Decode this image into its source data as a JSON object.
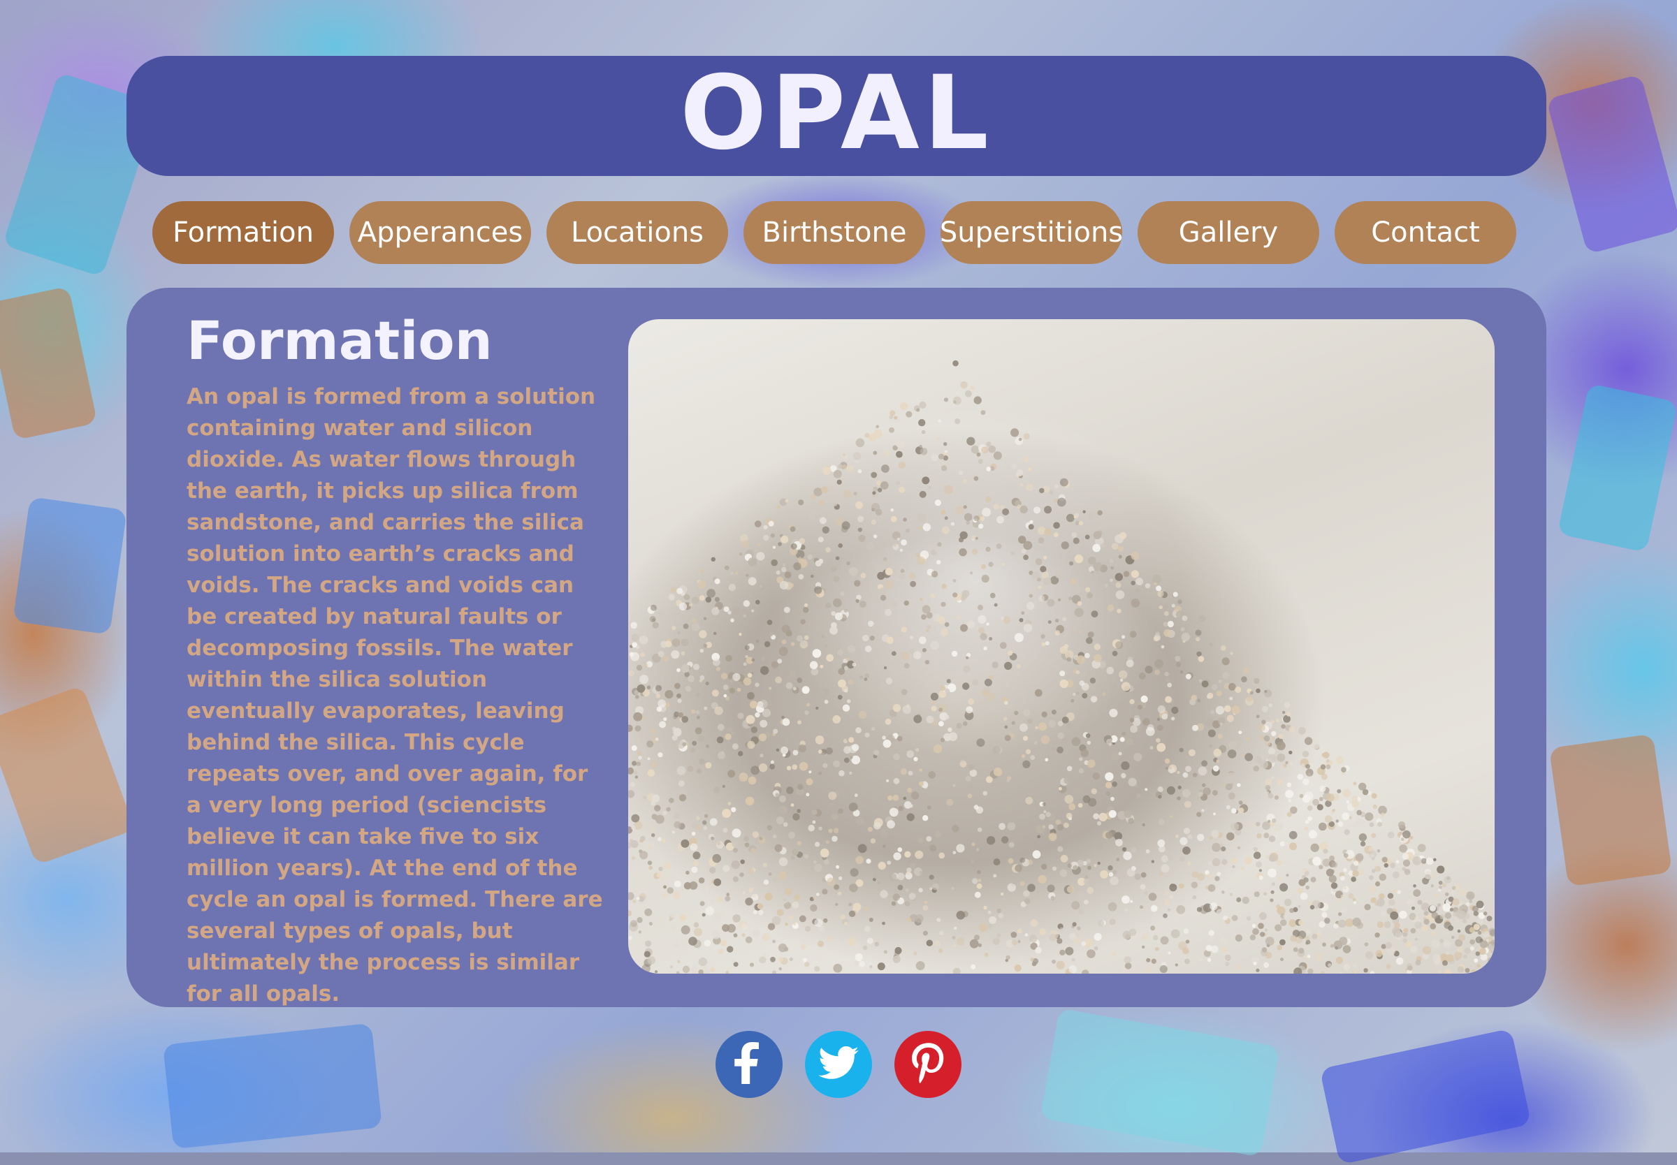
{
  "site": {
    "title": "OPAL"
  },
  "nav": {
    "items": [
      {
        "label": "Formation",
        "active": true
      },
      {
        "label": "Apperances",
        "active": false
      },
      {
        "label": "Locations",
        "active": false
      },
      {
        "label": "Birthstone",
        "active": false
      },
      {
        "label": "Superstitions",
        "active": false
      },
      {
        "label": "Gallery",
        "active": false
      },
      {
        "label": "Contact",
        "active": false
      }
    ]
  },
  "content": {
    "heading": "Formation",
    "body": "An opal is formed from a solution containing water and silicon dioxide. As water flows through the earth, it picks up silica from sandstone, and carries the silica solution into earth’s cracks and voids. The cracks and voids can be created by natural faults or decomposing fossils. The water within the silica solution eventually evaporates, leaving behind the silica. This cycle repeats over, and over again, for a very long period (sciencists believe it can take five to six million years). At the end of the cycle an opal is formed. There are several types of opals, but ultimately the process is similar for all opals.",
    "image_subject": "pile-of-sand"
  },
  "social": {
    "items": [
      {
        "icon": "facebook-icon",
        "color": "#3b67b6"
      },
      {
        "icon": "twitter-icon",
        "color": "#1ab2ec"
      },
      {
        "icon": "pinterest-icon",
        "color": "#d51f2b"
      }
    ]
  },
  "colors": {
    "header_bg": "#4a50a0",
    "panel_bg": "#6e74b2",
    "nav_bg": "#b08256",
    "body_text": "#d4a784",
    "heading_text": "#f4f2ff"
  }
}
